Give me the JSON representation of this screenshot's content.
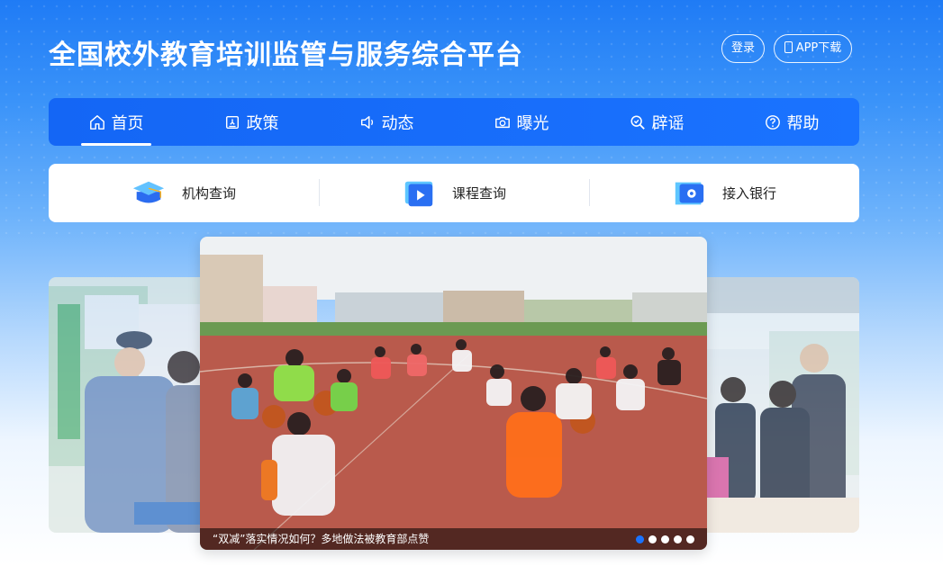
{
  "header": {
    "title": "全国校外教育培训监管与服务综合平台",
    "login_label": "登录",
    "app_label": "APP下载"
  },
  "nav": {
    "items": [
      {
        "label": "首页",
        "icon": "home-icon",
        "active": true
      },
      {
        "label": "政策",
        "icon": "policy-icon"
      },
      {
        "label": "动态",
        "icon": "megaphone-icon"
      },
      {
        "label": "曝光",
        "icon": "camera-icon"
      },
      {
        "label": "辟谣",
        "icon": "search-check-icon"
      },
      {
        "label": "帮助",
        "icon": "help-icon"
      }
    ]
  },
  "quick": {
    "items": [
      {
        "label": "机构查询",
        "icon": "graduation-cap-icon"
      },
      {
        "label": "课程查询",
        "icon": "video-play-icon"
      },
      {
        "label": "接入银行",
        "icon": "bank-card-icon"
      }
    ]
  },
  "carousel": {
    "caption": "“双减”落实情况如何？多地做法被教育部点赞",
    "slide_count": 5,
    "active_index": 0
  },
  "colors": {
    "brand_blue": "#1a73ff",
    "nav_bg": "#1466f5"
  }
}
